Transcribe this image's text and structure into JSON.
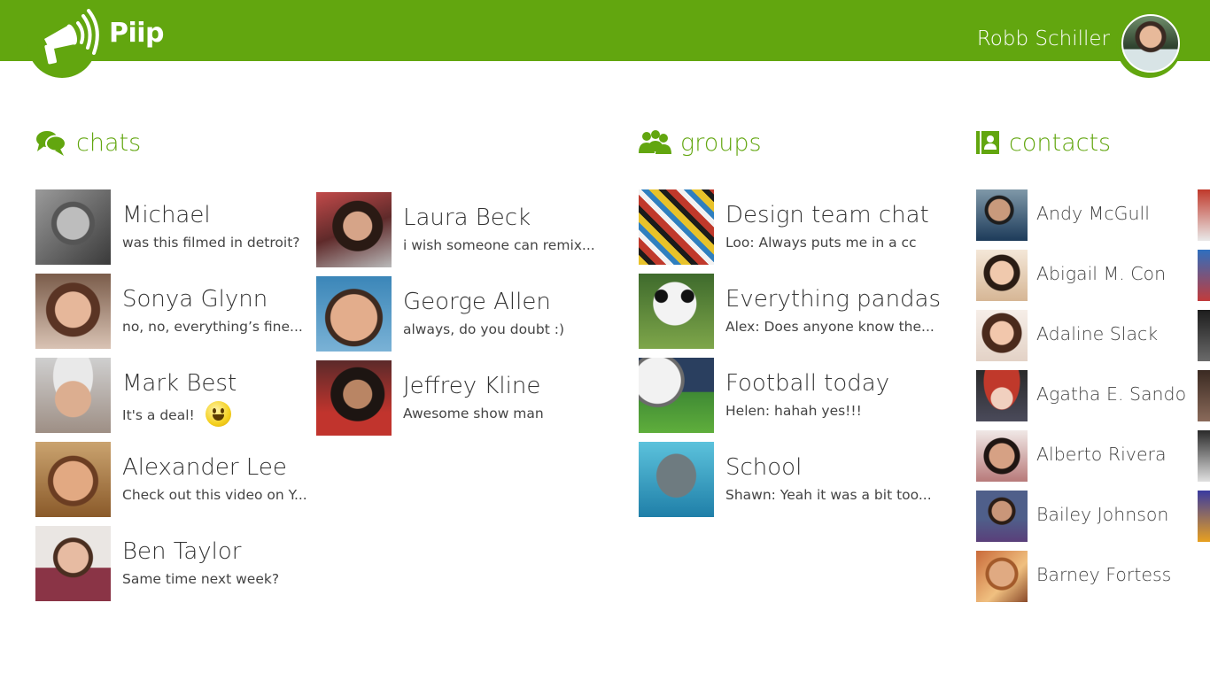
{
  "app": {
    "title": "Piip",
    "brand_color": "#62a60f"
  },
  "user": {
    "name": "Robb Schiller"
  },
  "sections": {
    "chats": {
      "label": "chats",
      "icon": "chat-bubbles-icon"
    },
    "groups": {
      "label": "groups",
      "icon": "people-group-icon"
    },
    "contacts": {
      "label": "contacts",
      "icon": "contact-card-icon"
    }
  },
  "chats": [
    {
      "name": "Michael",
      "message": "was this filmed in detroit?"
    },
    {
      "name": "Sonya Glynn",
      "message": "no, no, everything’s fine..."
    },
    {
      "name": "Mark Best",
      "message": "It's a deal!",
      "emoji": "smiley-emoji"
    },
    {
      "name": "Alexander Lee",
      "message": "Check out this video on Y..."
    },
    {
      "name": "Ben Taylor",
      "message": "Same time next week?"
    },
    {
      "name": "Laura Beck",
      "message": "i wish someone can remix..."
    },
    {
      "name": "George Allen",
      "message": "always, do you doubt :)"
    },
    {
      "name": "Jeffrey Kline",
      "message": "Awesome show man"
    }
  ],
  "groups": [
    {
      "name": "Design team chat",
      "message": "Loo: Always puts me in a cc"
    },
    {
      "name": "Everything pandas",
      "message": "Alex: Does anyone know the..."
    },
    {
      "name": "Football today",
      "message": "Helen: hahah yes!!!"
    },
    {
      "name": "School",
      "message": "Shawn: Yeah it was a bit too..."
    }
  ],
  "contacts": [
    {
      "name": "Andy McGull"
    },
    {
      "name": "Abigail M. Con"
    },
    {
      "name": "Adaline Slack"
    },
    {
      "name": "Agatha E. Sando"
    },
    {
      "name": "Alberto Rivera"
    },
    {
      "name": "Bailey Johnson"
    },
    {
      "name": "Barney Fortess"
    }
  ]
}
